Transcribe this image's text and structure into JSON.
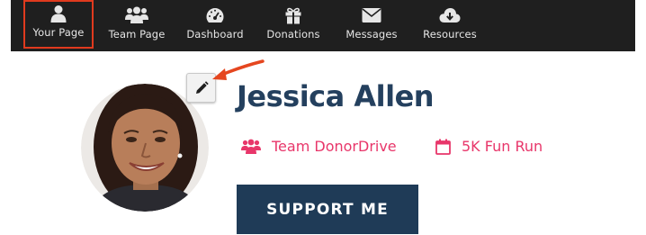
{
  "nav": {
    "items": [
      {
        "label": "Your Page",
        "icon": "user-icon",
        "active": true
      },
      {
        "label": "Team Page",
        "icon": "team-icon"
      },
      {
        "label": "Dashboard",
        "icon": "dashboard-icon"
      },
      {
        "label": "Donations",
        "icon": "gift-icon"
      },
      {
        "label": "Messages",
        "icon": "envelope-icon"
      },
      {
        "label": "Resources",
        "icon": "cloud-download-icon"
      }
    ],
    "background": "#1f1f1f",
    "active_outline": "#e03a1e"
  },
  "profile": {
    "name": "Jessica Allen",
    "team": "Team DonorDrive",
    "event": "5K Fun Run",
    "support_label": "SUPPORT ME",
    "name_color": "#24405e",
    "meta_color": "#e8366a",
    "button_color": "#1f3b57"
  }
}
